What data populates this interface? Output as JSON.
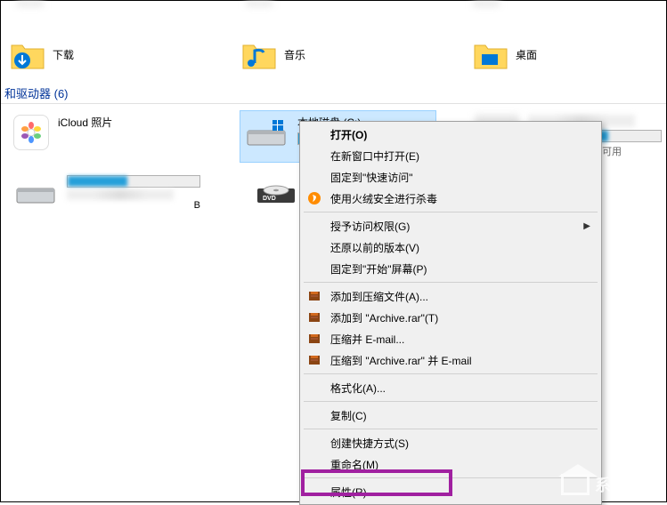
{
  "folders": {
    "downloads": "下载",
    "music": "音乐",
    "desktop": "桌面"
  },
  "section_header": "和驱动器 (6)",
  "drives": {
    "icloud": "iCloud 照片",
    "local_c": "本地磁盘 (C:)",
    "dvd": "DVD",
    "available_suffix": "可用"
  },
  "context_menu": {
    "open": "打开(O)",
    "open_new_window": "在新窗口中打开(E)",
    "pin_quick_access": "固定到\"快速访问\"",
    "huorong_scan": "使用火绒安全进行杀毒",
    "grant_access": "授予访问权限(G)",
    "restore_previous": "还原以前的版本(V)",
    "pin_start": "固定到\"开始\"屏幕(P)",
    "add_to_archive": "添加到压缩文件(A)...",
    "add_to_archive_rar": "添加到 \"Archive.rar\"(T)",
    "compress_email": "压缩并 E-mail...",
    "compress_rar_email": "压缩到 \"Archive.rar\" 并 E-mail",
    "format": "格式化(A)...",
    "copy": "复制(C)",
    "create_shortcut": "创建快捷方式(S)",
    "rename": "重命名(M)",
    "properties": "属性(R)"
  },
  "watermark": "系统之家",
  "colors": {
    "selection_bg": "#cce8ff",
    "link_blue": "#003399",
    "highlight": "#a020a0",
    "capacity_blue": "#26a0da"
  }
}
